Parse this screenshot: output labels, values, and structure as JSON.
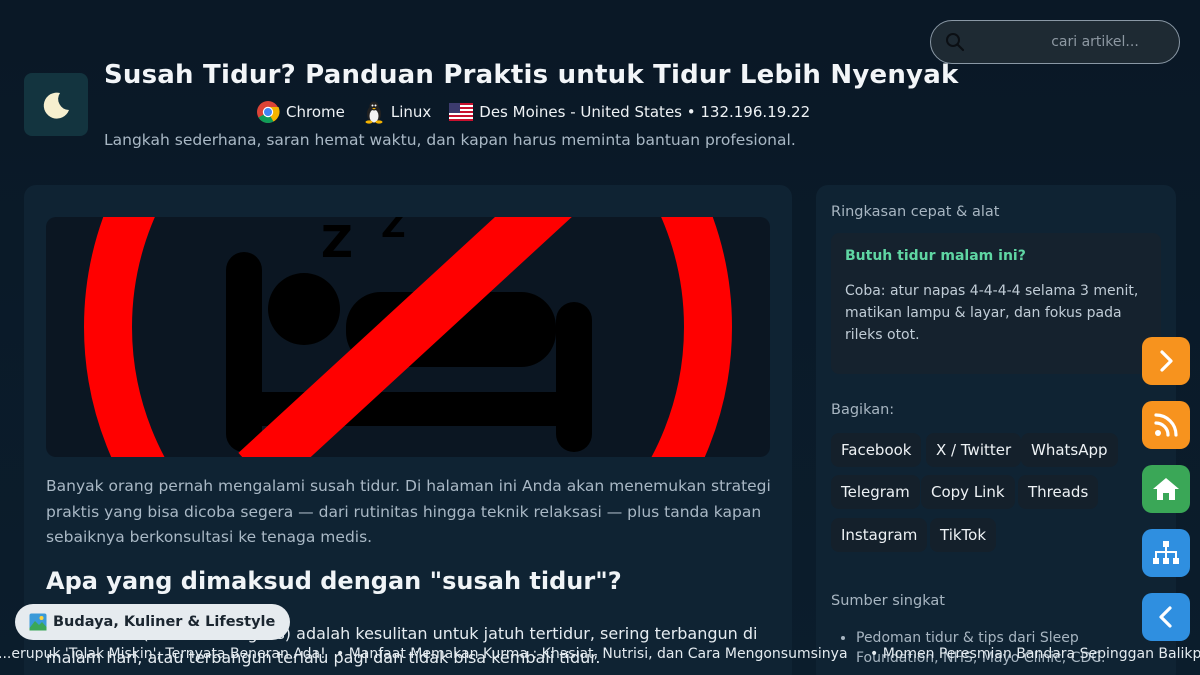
{
  "header": {
    "logo_icon": "moon-icon",
    "title": "Susah Tidur? Panduan Praktis untuk Tidur Lebih Nyenyak",
    "browser": "Chrome",
    "os": "Linux",
    "location": "Des Moines - United States • 132.196.19.22",
    "subtitle": "Langkah sederhana, saran hemat waktu, dan kapan harus meminta bantuan profesional."
  },
  "search": {
    "placeholder": "cari artikel..."
  },
  "article": {
    "hero_icon": "no-sleep-icon",
    "intro": "Banyak orang pernah mengalami susah tidur. Di halaman ini Anda akan menemukan strategi praktis yang bisa dicoba segera — dari rutinitas hingga teknik relaksasi — plus tanda kapan sebaiknya berkonsultasi ke tenaga medis.",
    "heading": "Apa yang dimaksud dengan \"susah tidur\"?",
    "paragraph": "Susah tidur (insomnia ringkas) adalah kesulitan untuk jatuh tertidur, sering terbangun di malam hari, atau terbangun terlalu pagi dan tidak bisa kembali tidur."
  },
  "sidebar": {
    "title": "Ringkasan cepat & alat",
    "quick_heading": "Butuh tidur malam ini?",
    "quick_text": "Coba: atur napas 4-4-4-4 selama 3 menit, matikan lampu & layar, dan fokus pada rileks otot.",
    "share_label": "Bagikan:",
    "share_buttons": [
      "Facebook",
      "X / Twitter",
      "WhatsApp",
      "Telegram",
      "Copy Link",
      "Threads",
      "Instagram",
      "TikTok"
    ],
    "sources_label": "Sumber singkat",
    "sources": [
      "Pedoman tidur & tips dari Sleep Foundation, NHS, Mayo Clinic, CDC."
    ]
  },
  "fabs": [
    {
      "icon": "chevron-right-icon",
      "color": "#f7931e"
    },
    {
      "icon": "rss-icon",
      "color": "#f7931e"
    },
    {
      "icon": "home-icon",
      "color": "#3aa757"
    },
    {
      "icon": "sitemap-icon",
      "color": "#2f8fe0"
    },
    {
      "icon": "chevron-left-icon",
      "color": "#2f8fe0"
    }
  ],
  "category_pill": {
    "icon": "image-icon",
    "label": "Budaya, Kuliner & Lifestyle"
  },
  "ticker": [
    "...erupuk 'Tolak Miskin', Ternyata Beneran Ada!",
    "• Manfaat Memakan Kurma : Khasiat, Nutrisi, dan Cara Mengonsumsinya",
    "• Momen Peresmian Bandara Sepinggan Balikpapan"
  ]
}
